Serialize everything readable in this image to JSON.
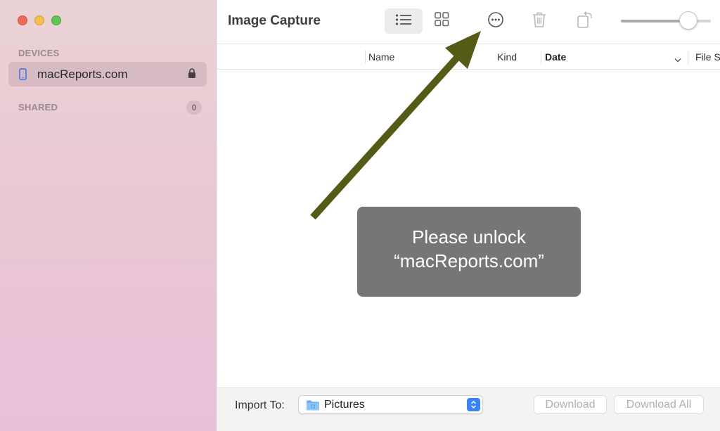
{
  "window": {
    "traffic_lights": [
      "close",
      "minimize",
      "zoom"
    ]
  },
  "sidebar": {
    "devices_title": "DEVICES",
    "device": {
      "name": "macReports.com",
      "icon": "iphone-icon",
      "locked": true
    },
    "shared_title": "SHARED",
    "shared_count": "0"
  },
  "toolbar": {
    "title": "Image Capture",
    "buttons": [
      "list-view",
      "grid-view",
      "more-options",
      "delete",
      "rotate"
    ],
    "thumbnail_size": 0.75
  },
  "columns": {
    "name": "Name",
    "kind": "Kind",
    "date": "Date",
    "file_size": "File S"
  },
  "notice": {
    "line1": "Please unlock",
    "line2": "“macReports.com”"
  },
  "bottom": {
    "import_label": "Import To:",
    "import_value": "Pictures",
    "download": "Download",
    "download_all": "Download All"
  },
  "colors": {
    "annotation_arrow": "#555a16",
    "notice_bg": "#767676",
    "accent": "#3b82f6"
  }
}
